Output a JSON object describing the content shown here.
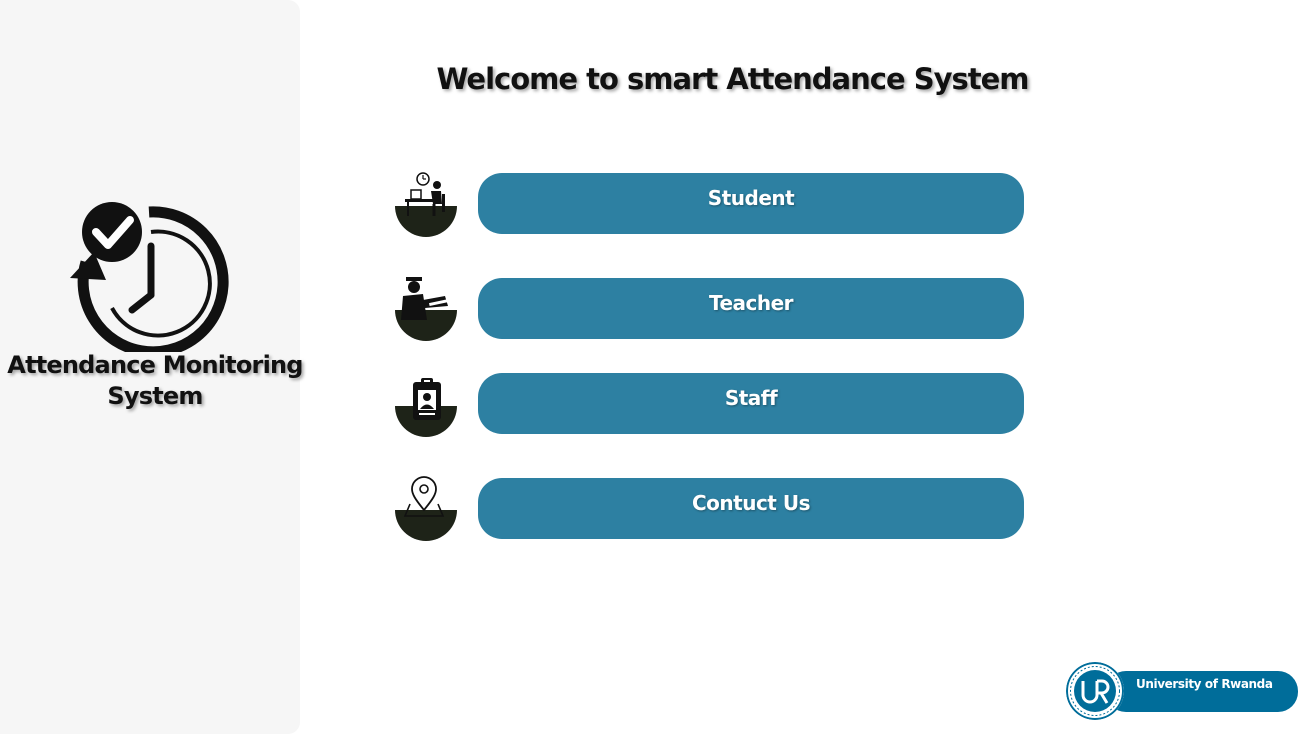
{
  "sidebar": {
    "logo_icon": "clock-check-icon",
    "title": "Attendance Monitoring System"
  },
  "main": {
    "welcome": "Welcome to smart Attendance System",
    "buttons": [
      {
        "label": "Student",
        "icon": "student-at-desk-icon"
      },
      {
        "label": "Teacher",
        "icon": "teacher-icon"
      },
      {
        "label": "Staff",
        "icon": "staff-id-badge-icon"
      },
      {
        "label": "Contuct Us",
        "icon": "location-pin-icon"
      }
    ]
  },
  "footer": {
    "university_logo": "ur-seal-icon",
    "university_name": "University of Rwanda"
  },
  "colors": {
    "sidebar_bg": "#f6f6f6",
    "button_bg": "#2d80a2",
    "icon_dark": "#1e2318",
    "university_blue": "#006d9a"
  }
}
